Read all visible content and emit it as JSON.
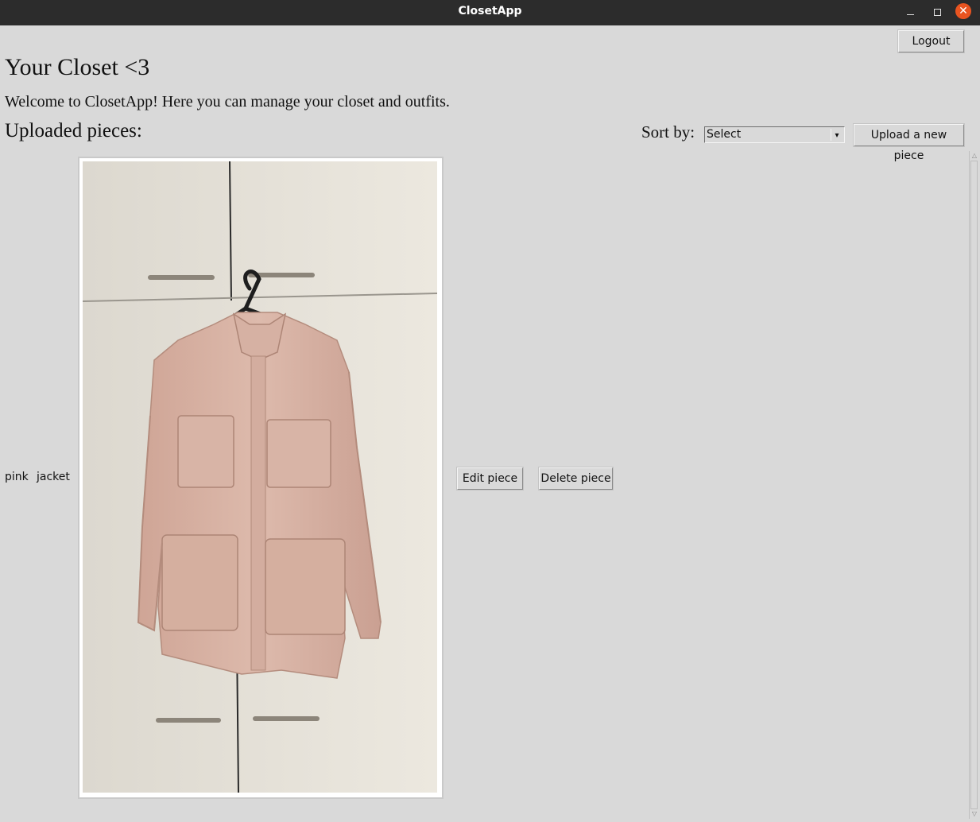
{
  "window": {
    "title": "ClosetApp"
  },
  "header": {
    "logout_label": "Logout"
  },
  "main": {
    "heading": "Your Closet <3",
    "welcome": "Welcome to ClosetApp! Here you can manage your closet and outfits.",
    "section_label": "Uploaded pieces:",
    "sort_label": "Sort by:",
    "sort_selected": "Select",
    "upload_label": "Upload a new piece"
  },
  "pieces": [
    {
      "color": "pink",
      "type": "jacket",
      "edit_label": "Edit piece",
      "delete_label": "Delete piece"
    }
  ],
  "colors": {
    "background": "#d9d9d9",
    "titlebar": "#2c2c2c",
    "close": "#e95420",
    "jacket": "#d9b6a8",
    "wall": "#e6e3dc"
  },
  "icons": {
    "minimize": "minimize-icon",
    "maximize": "maximize-icon",
    "close": "close-icon",
    "dropdown": "chevron-down-icon"
  }
}
